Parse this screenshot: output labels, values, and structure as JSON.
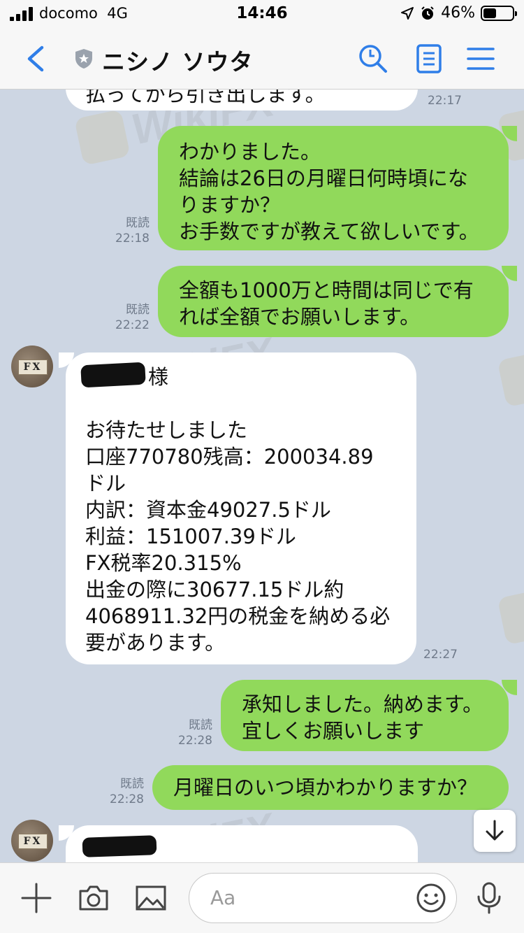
{
  "status_bar": {
    "carrier": "docomo",
    "network": "4G",
    "time": "14:46",
    "battery": "46%",
    "battery_level": 0.46
  },
  "nav": {
    "title": "ニシノ ソウタ",
    "icons": [
      "back-chevron-icon",
      "shield-icon",
      "search-icon",
      "notes-icon",
      "menu-icon"
    ],
    "accent": "#2f7ee8"
  },
  "messages": {
    "m0": {
      "lines": [
        "払ってから引き出します。"
      ],
      "time": "22:17"
    },
    "m1": {
      "lines": [
        "わかりました。",
        "結論は26日の月曜日何時頃にな",
        "りますか？",
        "お手数ですが教えて欲しいです。"
      ],
      "read": "既読",
      "time": "22:18"
    },
    "m2": {
      "lines": [
        "全額も1000万と時間は同じで有",
        "れば全額でお願いします。"
      ],
      "read": "既読",
      "time": "22:22"
    },
    "m3": {
      "lines": [
        "様",
        "",
        "お待たせしました",
        "口座770780残高：200034.89",
        "ドル",
        "内訳：資本金49027.5ドル",
        "利益：151007.39ドル",
        "FX税率20.315%",
        "出金の際に30677.15ドル約",
        "4068911.32円の税金を納める必",
        "要があります。"
      ],
      "time": "22:27"
    },
    "m4": {
      "lines": [
        "承知しました。納めます。",
        "宜しくお願いします"
      ],
      "read": "既読",
      "time": "22:28"
    },
    "m5": {
      "lines": [
        "月曜日のいつ頃かわかりますか？"
      ],
      "read": "既読",
      "time": "22:28"
    }
  },
  "avatar_label": "FX",
  "watermark": "WikiFX",
  "input": {
    "placeholder": "Aa"
  },
  "colors": {
    "outgoing_bubble": "#91d95b",
    "incoming_bubble": "#ffffff",
    "chat_bg": "#cdd6e3"
  }
}
